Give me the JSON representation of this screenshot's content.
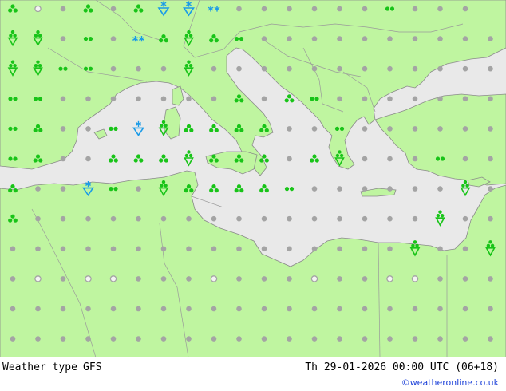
{
  "footer": {
    "title": "Weather type",
    "model": "GFS",
    "valid": "Th 29-01-2026 00:00 UTC (06+18)",
    "credit": "©weatheronline.co.uk"
  },
  "colors": {
    "sea": "#e9e9e9",
    "land": "#bff5a0",
    "border": "#9a9a9a",
    "coast": "#8a8a8a",
    "dot": "#a4a4a4",
    "precip": "#18c418",
    "snow": "#1a9be8"
  },
  "legend_symbols": {
    "r": "rain-showers-icon",
    "s": "drizzle-icon",
    "k": "heavy-showers-icon",
    "v": "snow-showers-icon",
    "w": "snow-icon",
    "d": "fair-dot-icon",
    "c": "cloudy-icon"
  },
  "grid": {
    "cols": 20,
    "rows": 12,
    "symbols": [
      "rcdrdrvvwddddddsddd",
      "kkdsdwrkrsdddddddddd",
      "kkssdddkddddddddddddd",
      "ssdddddddrdrsdddddddd",
      "srddsvkrrrrddsddddddd",
      "srddrrrkrrrdrkdddsddd",
      "rddvsdkrrrrsddddddkdk",
      "rddddddddddddddddkddk",
      "ddddddddddddddddkddk",
      "dcdccdddcdddcddccddd",
      "ddddddddddddddddddddd",
      "ddddddddddddddddddddd"
    ]
  }
}
